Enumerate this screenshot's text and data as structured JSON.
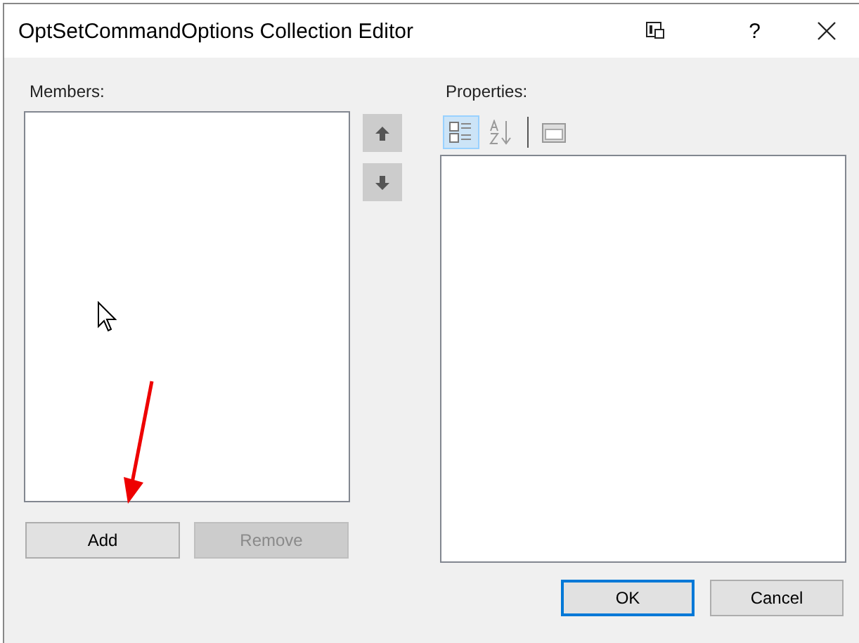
{
  "window": {
    "title": "OptSetCommandOptions Collection Editor",
    "help": "?"
  },
  "members": {
    "label": "Members:",
    "move_buttons": [
      {
        "kind": "up",
        "disabled": true
      },
      {
        "kind": "down",
        "disabled": true
      }
    ],
    "buttons": [
      {
        "label": "Add",
        "disabled": false
      },
      {
        "label": "Remove",
        "disabled": true
      }
    ]
  },
  "properties": {
    "label": "Properties:",
    "toolbar": [
      {
        "kind": "categorized",
        "selected": true
      },
      {
        "kind": "alphabetical",
        "selected": false
      },
      {
        "kind": "pages",
        "selected": false
      }
    ]
  },
  "buttons": [
    {
      "label": "OK",
      "default": true
    },
    {
      "label": "Cancel",
      "default": false
    }
  ]
}
